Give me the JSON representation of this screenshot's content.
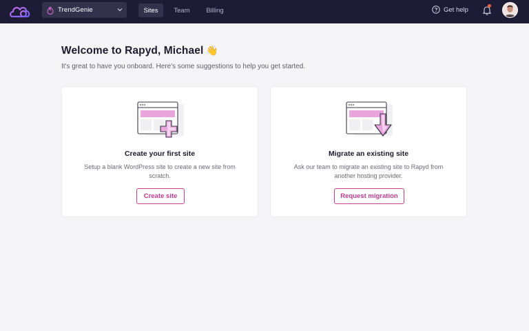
{
  "topbar": {
    "workspace": {
      "name": "TrendGenie",
      "icon": "flame-icon"
    },
    "tabs": [
      {
        "label": "Sites",
        "active": true
      },
      {
        "label": "Team",
        "active": false
      },
      {
        "label": "Billing",
        "active": false
      }
    ],
    "help_label": "Get help",
    "notification_unread": true
  },
  "main": {
    "title": "Welcome to Rapyd, Michael",
    "title_emoji": "👋",
    "subtitle": "It's great to have you onboard. Here's some suggestions to help you get started.",
    "cards": [
      {
        "title": "Create your first site",
        "description": "Setup a blank WordPress site to create a new site from scratch.",
        "button": "Create site",
        "icon": "browser-plus-icon"
      },
      {
        "title": "Migrate an existing site",
        "description": "Ask our team to migrate an existing site to Rapyd from another hosting provider.",
        "button": "Request migration",
        "icon": "browser-download-icon"
      }
    ]
  },
  "colors": {
    "topbar": "#1e1b36",
    "accent": "#c43e93",
    "illustration_pink": "#e9a6dd",
    "background": "#f5f5f7"
  }
}
